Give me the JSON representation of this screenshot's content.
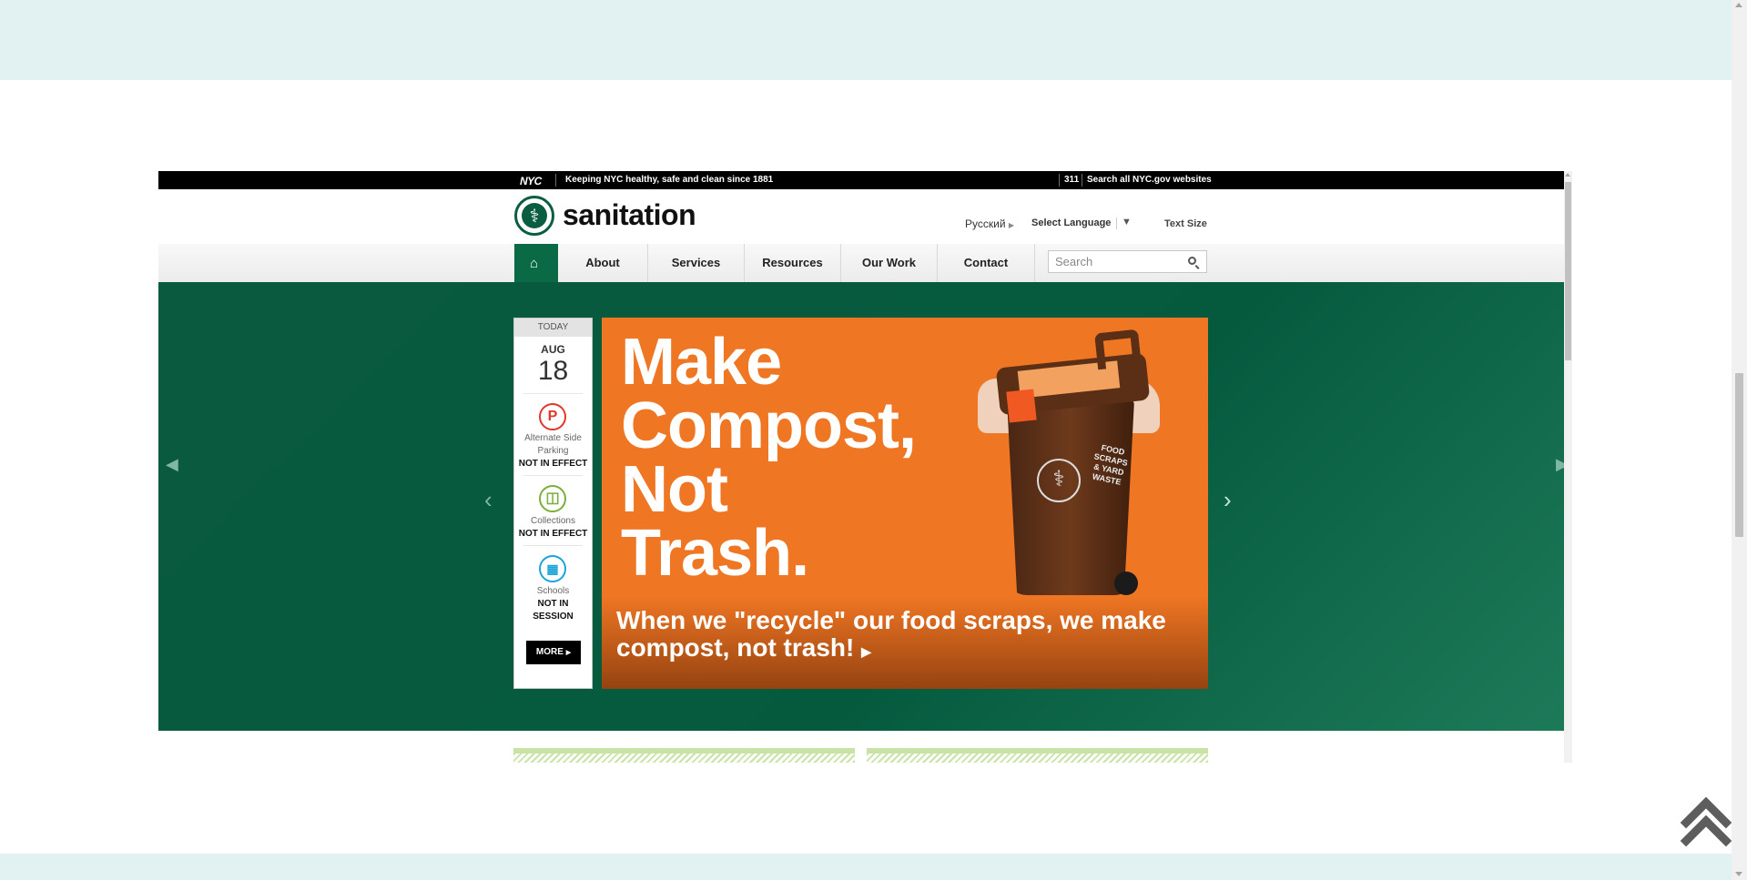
{
  "topbar": {
    "logo": "NYC",
    "tagline": "Keeping NYC healthy, safe and clean since 1881",
    "n311": "311",
    "search_all": "Search all NYC.gov websites"
  },
  "header": {
    "logo_text": "sanitation",
    "language_current": "Русский",
    "language_select": "Select Language",
    "text_size": "Text Size"
  },
  "nav": {
    "items": [
      "About",
      "Services",
      "Resources",
      "Our Work",
      "Contact"
    ],
    "search_placeholder": "Search"
  },
  "today_panel": {
    "label": "TODAY",
    "month": "AUG",
    "day": "18",
    "statuses": [
      {
        "name": "Alternate Side Parking",
        "value": "NOT IN EFFECT",
        "icon": "no-parking-icon",
        "color": "#e2372b"
      },
      {
        "name": "Collections",
        "value": "NOT IN EFFECT",
        "icon": "trash-can-icon",
        "color": "#7ab03a"
      },
      {
        "name": "Schools",
        "value": "NOT IN SESSION",
        "icon": "book-icon",
        "color": "#1aa5d6"
      }
    ],
    "more_label": "MORE"
  },
  "slide": {
    "headline": "Make\nCompost,\nNot\nTrash.",
    "caption": "When we \"recycle\" our food scraps, we make compost, not trash!",
    "bin_label": "FOOD SCRAPS & YARD WASTE"
  },
  "colors": {
    "brand_green": "#0b6a46",
    "hero_green": "#055a3e",
    "slide_orange": "#ef7623"
  }
}
